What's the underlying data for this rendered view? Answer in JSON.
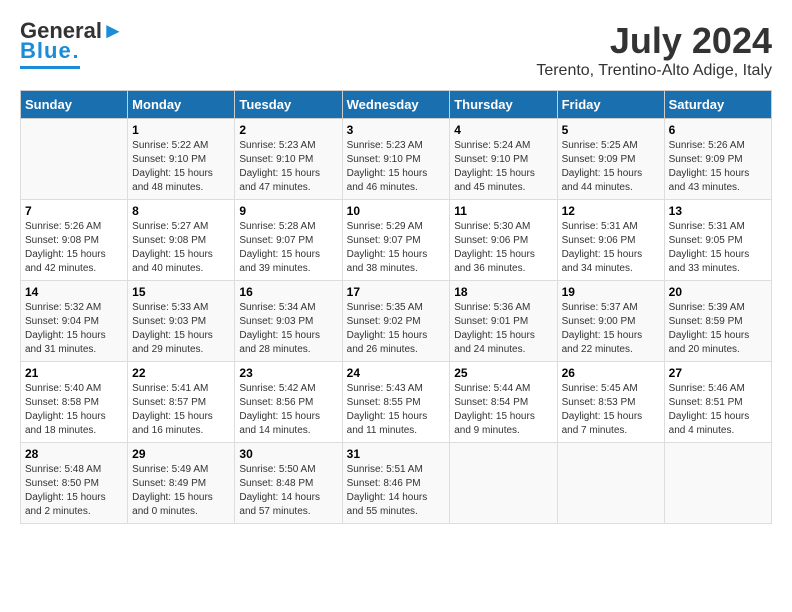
{
  "header": {
    "logo_line1": "General",
    "logo_line2": "Blue",
    "month": "July 2024",
    "location": "Terento, Trentino-Alto Adige, Italy"
  },
  "columns": [
    "Sunday",
    "Monday",
    "Tuesday",
    "Wednesday",
    "Thursday",
    "Friday",
    "Saturday"
  ],
  "weeks": [
    [
      {
        "day": "",
        "info": ""
      },
      {
        "day": "1",
        "info": "Sunrise: 5:22 AM\nSunset: 9:10 PM\nDaylight: 15 hours\nand 48 minutes."
      },
      {
        "day": "2",
        "info": "Sunrise: 5:23 AM\nSunset: 9:10 PM\nDaylight: 15 hours\nand 47 minutes."
      },
      {
        "day": "3",
        "info": "Sunrise: 5:23 AM\nSunset: 9:10 PM\nDaylight: 15 hours\nand 46 minutes."
      },
      {
        "day": "4",
        "info": "Sunrise: 5:24 AM\nSunset: 9:10 PM\nDaylight: 15 hours\nand 45 minutes."
      },
      {
        "day": "5",
        "info": "Sunrise: 5:25 AM\nSunset: 9:09 PM\nDaylight: 15 hours\nand 44 minutes."
      },
      {
        "day": "6",
        "info": "Sunrise: 5:26 AM\nSunset: 9:09 PM\nDaylight: 15 hours\nand 43 minutes."
      }
    ],
    [
      {
        "day": "7",
        "info": "Sunrise: 5:26 AM\nSunset: 9:08 PM\nDaylight: 15 hours\nand 42 minutes."
      },
      {
        "day": "8",
        "info": "Sunrise: 5:27 AM\nSunset: 9:08 PM\nDaylight: 15 hours\nand 40 minutes."
      },
      {
        "day": "9",
        "info": "Sunrise: 5:28 AM\nSunset: 9:07 PM\nDaylight: 15 hours\nand 39 minutes."
      },
      {
        "day": "10",
        "info": "Sunrise: 5:29 AM\nSunset: 9:07 PM\nDaylight: 15 hours\nand 38 minutes."
      },
      {
        "day": "11",
        "info": "Sunrise: 5:30 AM\nSunset: 9:06 PM\nDaylight: 15 hours\nand 36 minutes."
      },
      {
        "day": "12",
        "info": "Sunrise: 5:31 AM\nSunset: 9:06 PM\nDaylight: 15 hours\nand 34 minutes."
      },
      {
        "day": "13",
        "info": "Sunrise: 5:31 AM\nSunset: 9:05 PM\nDaylight: 15 hours\nand 33 minutes."
      }
    ],
    [
      {
        "day": "14",
        "info": "Sunrise: 5:32 AM\nSunset: 9:04 PM\nDaylight: 15 hours\nand 31 minutes."
      },
      {
        "day": "15",
        "info": "Sunrise: 5:33 AM\nSunset: 9:03 PM\nDaylight: 15 hours\nand 29 minutes."
      },
      {
        "day": "16",
        "info": "Sunrise: 5:34 AM\nSunset: 9:03 PM\nDaylight: 15 hours\nand 28 minutes."
      },
      {
        "day": "17",
        "info": "Sunrise: 5:35 AM\nSunset: 9:02 PM\nDaylight: 15 hours\nand 26 minutes."
      },
      {
        "day": "18",
        "info": "Sunrise: 5:36 AM\nSunset: 9:01 PM\nDaylight: 15 hours\nand 24 minutes."
      },
      {
        "day": "19",
        "info": "Sunrise: 5:37 AM\nSunset: 9:00 PM\nDaylight: 15 hours\nand 22 minutes."
      },
      {
        "day": "20",
        "info": "Sunrise: 5:39 AM\nSunset: 8:59 PM\nDaylight: 15 hours\nand 20 minutes."
      }
    ],
    [
      {
        "day": "21",
        "info": "Sunrise: 5:40 AM\nSunset: 8:58 PM\nDaylight: 15 hours\nand 18 minutes."
      },
      {
        "day": "22",
        "info": "Sunrise: 5:41 AM\nSunset: 8:57 PM\nDaylight: 15 hours\nand 16 minutes."
      },
      {
        "day": "23",
        "info": "Sunrise: 5:42 AM\nSunset: 8:56 PM\nDaylight: 15 hours\nand 14 minutes."
      },
      {
        "day": "24",
        "info": "Sunrise: 5:43 AM\nSunset: 8:55 PM\nDaylight: 15 hours\nand 11 minutes."
      },
      {
        "day": "25",
        "info": "Sunrise: 5:44 AM\nSunset: 8:54 PM\nDaylight: 15 hours\nand 9 minutes."
      },
      {
        "day": "26",
        "info": "Sunrise: 5:45 AM\nSunset: 8:53 PM\nDaylight: 15 hours\nand 7 minutes."
      },
      {
        "day": "27",
        "info": "Sunrise: 5:46 AM\nSunset: 8:51 PM\nDaylight: 15 hours\nand 4 minutes."
      }
    ],
    [
      {
        "day": "28",
        "info": "Sunrise: 5:48 AM\nSunset: 8:50 PM\nDaylight: 15 hours\nand 2 minutes."
      },
      {
        "day": "29",
        "info": "Sunrise: 5:49 AM\nSunset: 8:49 PM\nDaylight: 15 hours\nand 0 minutes."
      },
      {
        "day": "30",
        "info": "Sunrise: 5:50 AM\nSunset: 8:48 PM\nDaylight: 14 hours\nand 57 minutes."
      },
      {
        "day": "31",
        "info": "Sunrise: 5:51 AM\nSunset: 8:46 PM\nDaylight: 14 hours\nand 55 minutes."
      },
      {
        "day": "",
        "info": ""
      },
      {
        "day": "",
        "info": ""
      },
      {
        "day": "",
        "info": ""
      }
    ]
  ]
}
